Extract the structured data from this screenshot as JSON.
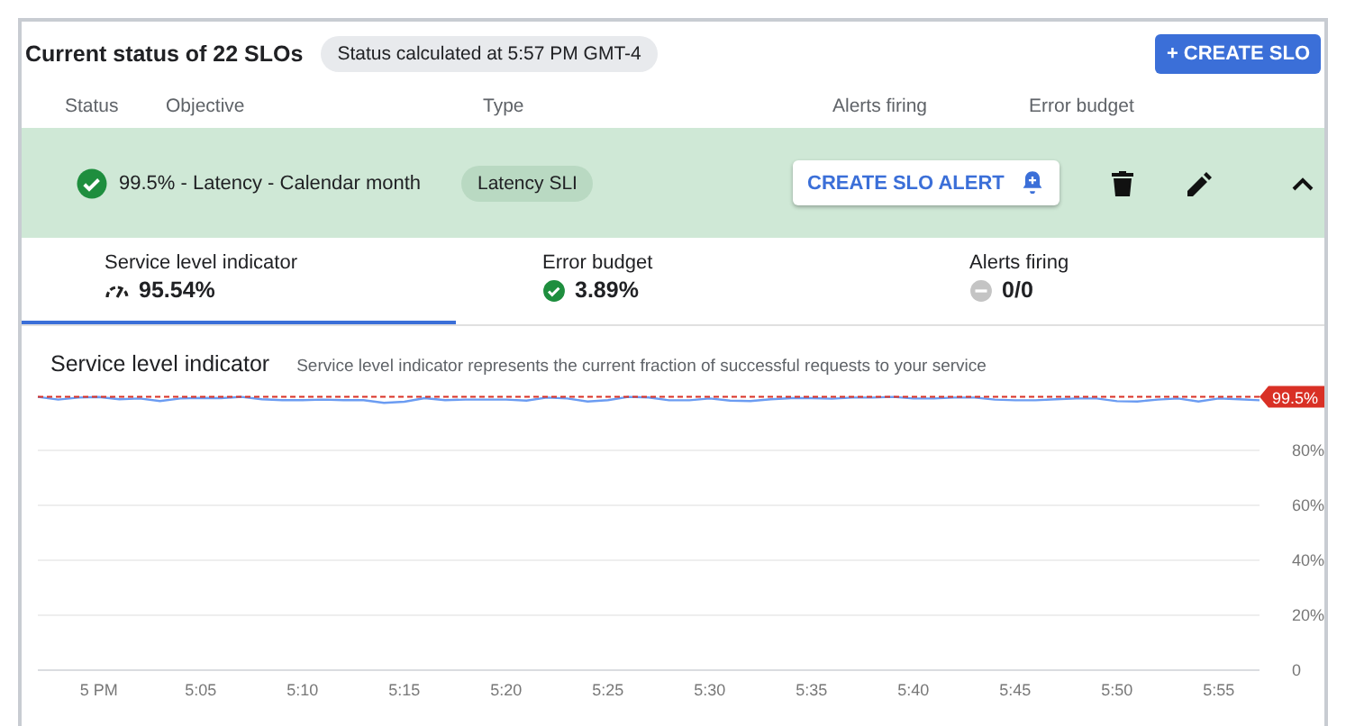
{
  "header": {
    "title": "Current status of 22 SLOs",
    "status_chip": "Status calculated at 5:57 PM GMT-4",
    "create_button": "+ CREATE SLO"
  },
  "columns": [
    "Status",
    "Objective",
    "Type",
    "Alerts firing",
    "Error budget"
  ],
  "slo": {
    "objective": "99.5% - Latency - Calendar month",
    "type_chip": "Latency SLI",
    "alert_button": "CREATE SLO ALERT",
    "expanded": true
  },
  "summary_tabs": [
    {
      "label": "Service level indicator",
      "value": "95.54%",
      "selected": true
    },
    {
      "label": "Error budget",
      "value": "3.89%",
      "selected": false
    },
    {
      "label": "Alerts firing",
      "value": "0/0",
      "selected": false
    }
  ],
  "chart_section": {
    "title": "Service level indicator",
    "description": "Service level indicator represents the current fraction of successful requests to your service",
    "chart_data": {
      "type": "line",
      "categories": [
        null,
        null,
        null,
        "5 PM",
        null,
        null,
        null,
        null,
        "5:05",
        null,
        null,
        null,
        null,
        "5:10",
        null,
        null,
        null,
        null,
        "5:15",
        null,
        null,
        null,
        null,
        "5:20",
        null,
        null,
        null,
        null,
        "5:25",
        null,
        null,
        null,
        null,
        "5:30",
        null,
        null,
        null,
        null,
        "5:35",
        null,
        null,
        null,
        null,
        "5:40",
        null,
        null,
        null,
        null,
        "5:45",
        null,
        null,
        null,
        null,
        "5:50",
        null,
        null,
        null,
        null,
        "5:55",
        null,
        null
      ],
      "series": [
        {
          "color": "#6b9cf2",
          "values": [
            99.5,
            98.5,
            99.2,
            99.4,
            98.6,
            98.9,
            98.0,
            98.9,
            99.1,
            99.0,
            99.5,
            98.6,
            98.3,
            98.3,
            98.5,
            98.3,
            98.3,
            97.3,
            97.7,
            99.0,
            98.3,
            98.5,
            98.5,
            98.5,
            98.1,
            99.2,
            98.9,
            97.8,
            98.3,
            99.5,
            99.3,
            98.2,
            98.2,
            98.9,
            98.1,
            98.0,
            98.6,
            99.0,
            99.0,
            98.8,
            99.2,
            99.2,
            99.5,
            98.9,
            98.9,
            99.2,
            99.2,
            98.5,
            98.2,
            98.2,
            98.6,
            98.9,
            98.9,
            97.9,
            97.8,
            98.5,
            98.9,
            97.8,
            98.9,
            98.6,
            98.2
          ]
        }
      ],
      "ylim": [
        0,
        100
      ],
      "grid": true,
      "yticks": [
        {
          "value": 0,
          "label": "0"
        },
        {
          "value": 20,
          "label": "20%"
        },
        {
          "value": 40,
          "label": "40%"
        },
        {
          "value": 60,
          "label": "60%"
        },
        {
          "value": 80,
          "label": "80%"
        }
      ],
      "ref_lines": [
        {
          "axis": "y",
          "value": 99.5,
          "label": "99.5%",
          "color": "#d93025"
        }
      ]
    }
  }
}
